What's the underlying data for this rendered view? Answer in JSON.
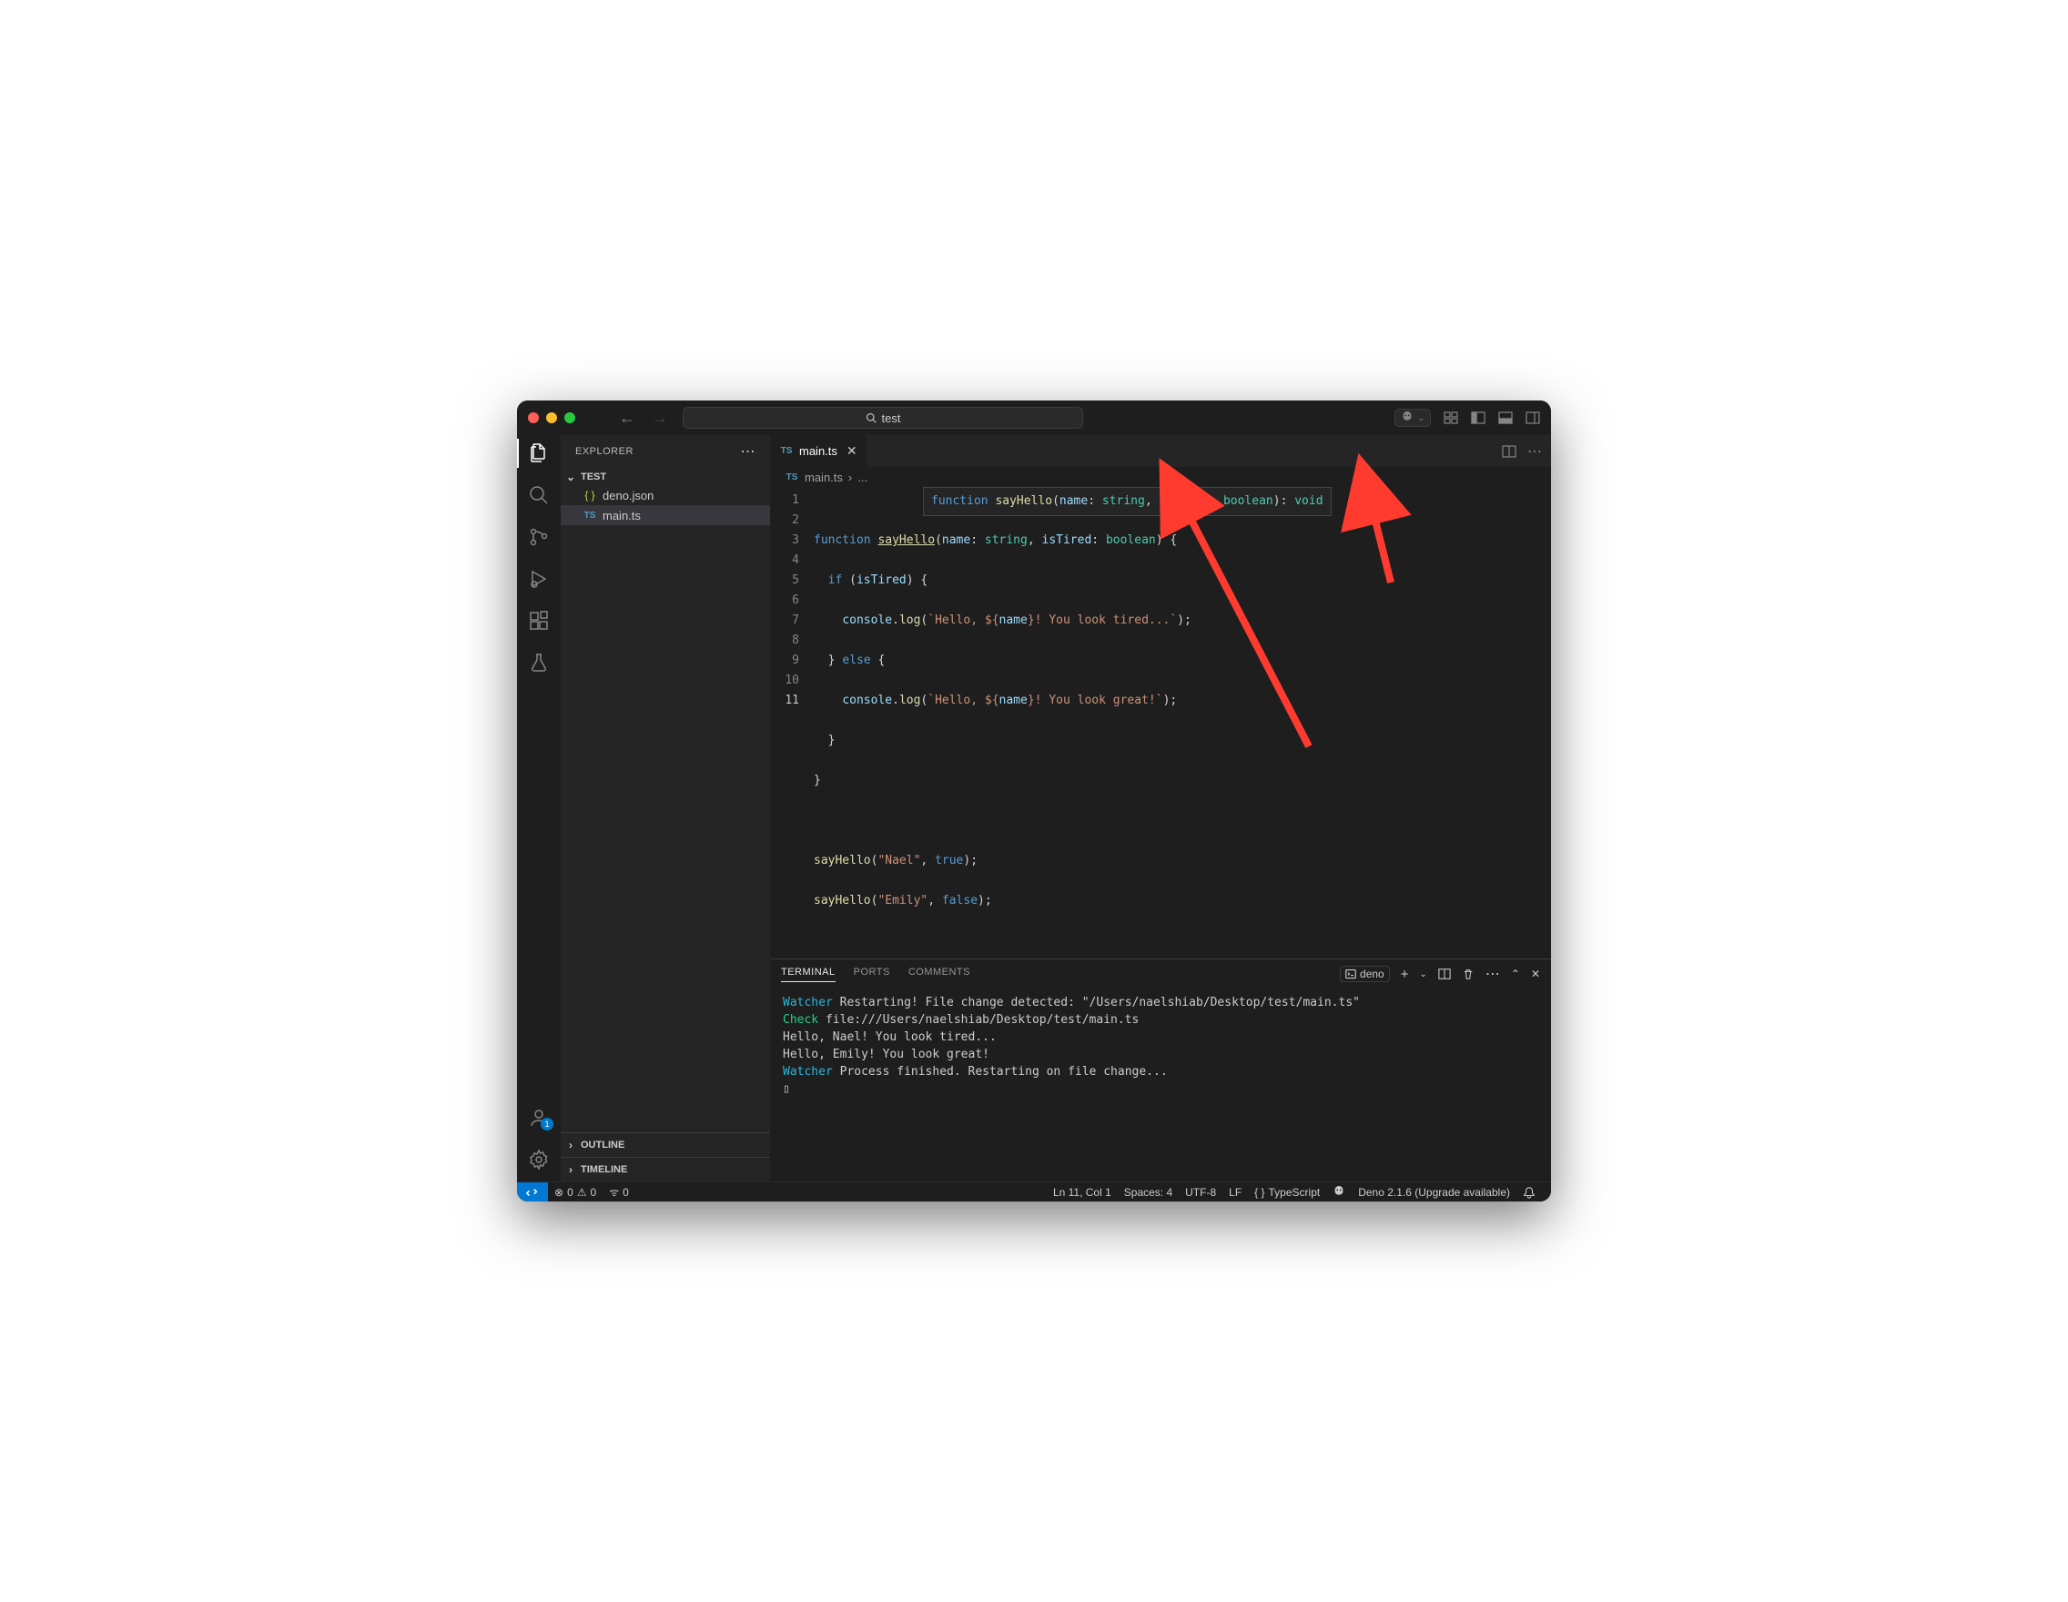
{
  "title": {
    "search": "test"
  },
  "sidebar": {
    "header": "EXPLORER",
    "project": "TEST",
    "files": [
      {
        "icon": "{ }",
        "name": "deno.json",
        "kind": "json"
      },
      {
        "icon": "TS",
        "name": "main.ts",
        "kind": "ts",
        "selected": true
      }
    ],
    "outline": "OUTLINE",
    "timeline": "TIMELINE"
  },
  "activity": {
    "accounts_badge": "1"
  },
  "tab": {
    "icon": "TS",
    "name": "main.ts"
  },
  "breadcrumb": {
    "icon": "TS",
    "file": "main.ts",
    "rest": "..."
  },
  "hover": {
    "kw": "function",
    "name": "sayHello",
    "p1": "name",
    "t1": "string",
    "p2": "isTired",
    "t2": "boolean",
    "ret": "void"
  },
  "code": {
    "lines": [
      "1",
      "2",
      "3",
      "4",
      "5",
      "6",
      "7",
      "8",
      "9",
      "10",
      "11"
    ],
    "l1a": "function",
    "l1b": "sayHello",
    "l1c": "name",
    "l1d": "string",
    "l1e": "isTired",
    "l1f": "boolean",
    "l2a": "if",
    "l2b": "isTired",
    "l3a": "console",
    "l3b": "log",
    "l3c": "`Hello, ${",
    "l3d": "name",
    "l3e": "}! You look tired...`",
    "l4a": "else",
    "l5a": "console",
    "l5b": "log",
    "l5c": "`Hello, ${",
    "l5d": "name",
    "l5e": "}! You look great!`",
    "l9a": "sayHello",
    "l9b": "\"Nael\"",
    "l9c": "true",
    "l10a": "sayHello",
    "l10b": "\"Emily\"",
    "l10c": "false"
  },
  "panel": {
    "tabs": [
      "TERMINAL",
      "PORTS",
      "COMMENTS"
    ],
    "name": "deno",
    "lines": {
      "l1a": "Watcher",
      "l1b": " Restarting! File change detected: \"/Users/naelshiab/Desktop/test/main.ts\"",
      "l2a": "Check",
      "l2b": " file:///Users/naelshiab/Desktop/test/main.ts",
      "l3": "Hello, Nael! You look tired...",
      "l4": "Hello, Emily! You look great!",
      "l5a": "Watcher",
      "l5b": " Process finished. Restarting on file change...",
      "cursor": "▯"
    }
  },
  "status": {
    "errors": "0",
    "warnings": "0",
    "ports": "0",
    "position": "Ln 11, Col 1",
    "spaces": "Spaces: 4",
    "encoding": "UTF-8",
    "eol": "LF",
    "lang": "TypeScript",
    "deno": "Deno 2.1.6 (Upgrade available)"
  }
}
